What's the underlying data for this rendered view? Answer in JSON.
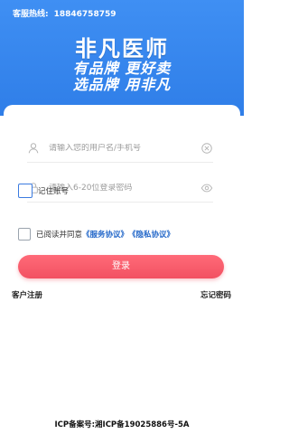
{
  "header": {
    "hotline_label": "客服热线:",
    "hotline_number": "18846758759",
    "brand": "非凡医师",
    "slogan_line1": "有品牌 更好卖",
    "slogan_line2": "选品牌 用非凡",
    "background_color": "#3a8af0"
  },
  "form": {
    "username_placeholder": "请输入您的用户名/手机号",
    "password_placeholder": "请输入6-20位登录密码",
    "remember_label": "记住账号",
    "agree_prefix": "已阅读并同意",
    "service_agreement": "《服务协议》",
    "privacy_agreement": "《隐私协议》",
    "login_label": "登录",
    "login_color": "#f25162",
    "link_color": "#2468c9"
  },
  "links": {
    "register": "客户注册",
    "forgot": "忘记密码"
  },
  "footer": {
    "icp": "ICP备案号:湘ICP备19025886号-5A"
  },
  "icons": [
    "user-icon",
    "clear-icon",
    "lock-icon",
    "eye-icon"
  ]
}
